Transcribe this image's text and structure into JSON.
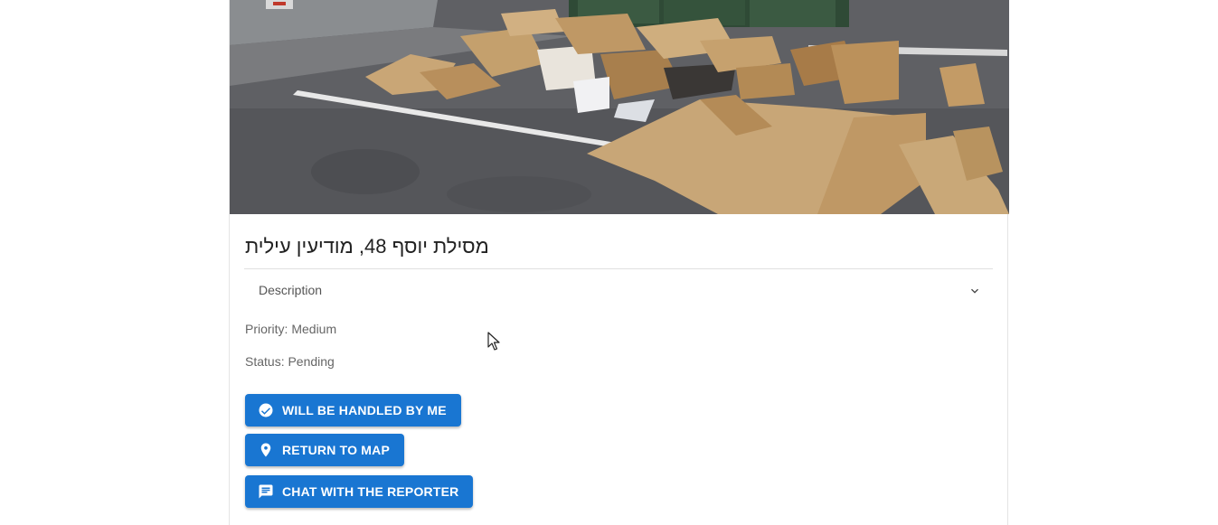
{
  "report": {
    "title": "מסילת יוסף 48, מודיעין עילית",
    "description_label": "Description",
    "priority": "Priority: Medium",
    "status": "Status: Pending"
  },
  "actions": {
    "handle_label": "WILL BE HANDLED BY ME",
    "map_label": "RETURN TO MAP",
    "chat_label": "CHAT WITH THE REPORTER"
  },
  "icons": {
    "photo": "report-photo",
    "chevron": "chevron-down-icon",
    "handle": "check-circle-icon",
    "map": "map-pin-icon",
    "chat": "chat-icon"
  },
  "colors": {
    "primary": "#1976d2",
    "text_dark": "#222222",
    "text_muted": "#666666"
  }
}
